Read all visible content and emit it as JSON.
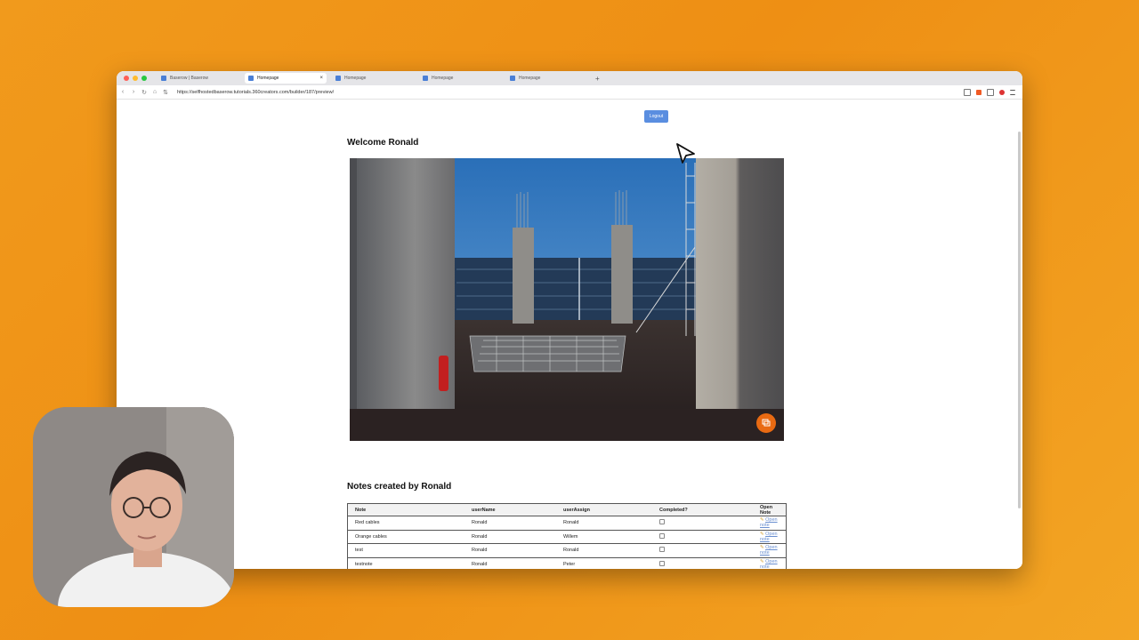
{
  "browser": {
    "tabs": [
      {
        "label": "Baserow | Baserow",
        "active": false
      },
      {
        "label": "Homepage",
        "active": true
      },
      {
        "label": "Homepage",
        "active": false
      },
      {
        "label": "Homepage",
        "active": false
      },
      {
        "label": "Homepage",
        "active": false
      }
    ],
    "new_tab_label": "+",
    "close_label": "×",
    "url": "https://selfhostedbaserow.tutorials.360creators.com/builder/187/preview/"
  },
  "page": {
    "logout_label": "Logout",
    "welcome_heading": "Welcome Ronald",
    "notes_heading": "Notes created by Ronald"
  },
  "table": {
    "headers": [
      "Note",
      "userName",
      "userAssign",
      "Completed?",
      "Open Note"
    ],
    "rows": [
      {
        "note": "Red cables",
        "user": "Ronald",
        "assign": "Ronald",
        "completed": false,
        "link": "Open note"
      },
      {
        "note": "Orange cables",
        "user": "Ronald",
        "assign": "Willem",
        "completed": false,
        "link": "Open note"
      },
      {
        "note": "test",
        "user": "Ronald",
        "assign": "Ronald",
        "completed": false,
        "link": "Open note"
      },
      {
        "note": "testnote",
        "user": "Ronald",
        "assign": "Peter",
        "completed": false,
        "link": "Open note"
      }
    ]
  },
  "colors": {
    "background": "#ee8f14",
    "logout_button": "#5a8ee0",
    "fab": "#e96a12",
    "link": "#6a8fd0"
  },
  "icons": [
    "back-icon",
    "forward-icon",
    "reload-icon",
    "home-icon",
    "site-settings-icon",
    "share-icon",
    "brave-shield-icon",
    "sidebar-icon",
    "menu-icon",
    "fullscreen-icon",
    "pencil-icon",
    "cursor-arrow-icon"
  ]
}
